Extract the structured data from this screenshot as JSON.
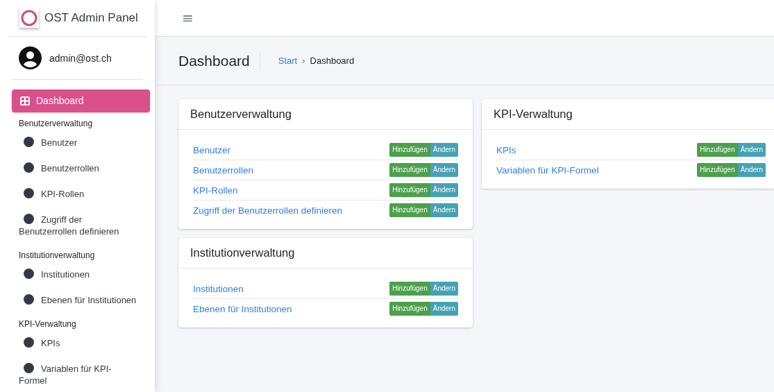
{
  "brand": {
    "title": "OST Admin Panel"
  },
  "user": {
    "email": "admin@ost.ch"
  },
  "sidebar": {
    "top_items": [
      {
        "label": "Dashboard",
        "selected": true
      }
    ],
    "sections": [
      {
        "header": "Benutzerverwaltung",
        "items": [
          {
            "label": "Benutzer",
            "selected": false
          },
          {
            "label": "Benutzerrollen",
            "selected": false
          },
          {
            "label": "KPI-Rollen",
            "selected": false
          },
          {
            "label": "Zugriff der Benutzerrollen definieren",
            "selected": false
          }
        ]
      },
      {
        "header": "Institutionverwaltung",
        "items": [
          {
            "label": "Institutionen",
            "selected": false
          },
          {
            "label": "Ebenen für Institutionen",
            "selected": false
          }
        ]
      },
      {
        "header": "KPI-Verwaltung",
        "items": [
          {
            "label": "KPIs",
            "selected": false
          },
          {
            "label": "Variablen für KPI-Formel",
            "selected": false
          }
        ]
      }
    ]
  },
  "topbar": {
    "menu_glyph": "≡"
  },
  "page": {
    "title": "Dashboard",
    "breadcrumb": [
      {
        "label": "Start",
        "link": true
      },
      {
        "label": "Dashboard",
        "link": false
      }
    ],
    "breadcrumb_separator": "›"
  },
  "columns": [
    [
      {
        "title": "Benutzerverwaltung",
        "rows": [
          {
            "label": "Benutzer",
            "add": "Hinzufügen",
            "edit": "Ändern"
          },
          {
            "label": "Benutzerrollen",
            "add": "Hinzufügen",
            "edit": "Ändern"
          },
          {
            "label": "KPI-Rollen",
            "add": "Hinzufügen",
            "edit": "Ändern"
          },
          {
            "label": "Zugriff der Benutzerrollen definieren",
            "add": "Hinzufügen",
            "edit": "Ändern"
          }
        ]
      },
      {
        "title": "Institutionverwaltung",
        "rows": [
          {
            "label": "Institutionen",
            "add": "Hinzufügen",
            "edit": "Ändern"
          },
          {
            "label": "Ebenen für Institutionen",
            "add": "Hinzufügen",
            "edit": "Ändern"
          }
        ]
      }
    ],
    [
      {
        "title": "KPI-Verwaltung",
        "rows": [
          {
            "label": "KPIs",
            "add": "Hinzufügen",
            "edit": "Ändern"
          },
          {
            "label": "Variablen für KPI-Formel",
            "add": "Hinzufügen",
            "edit": "Ändern"
          }
        ]
      }
    ]
  ]
}
